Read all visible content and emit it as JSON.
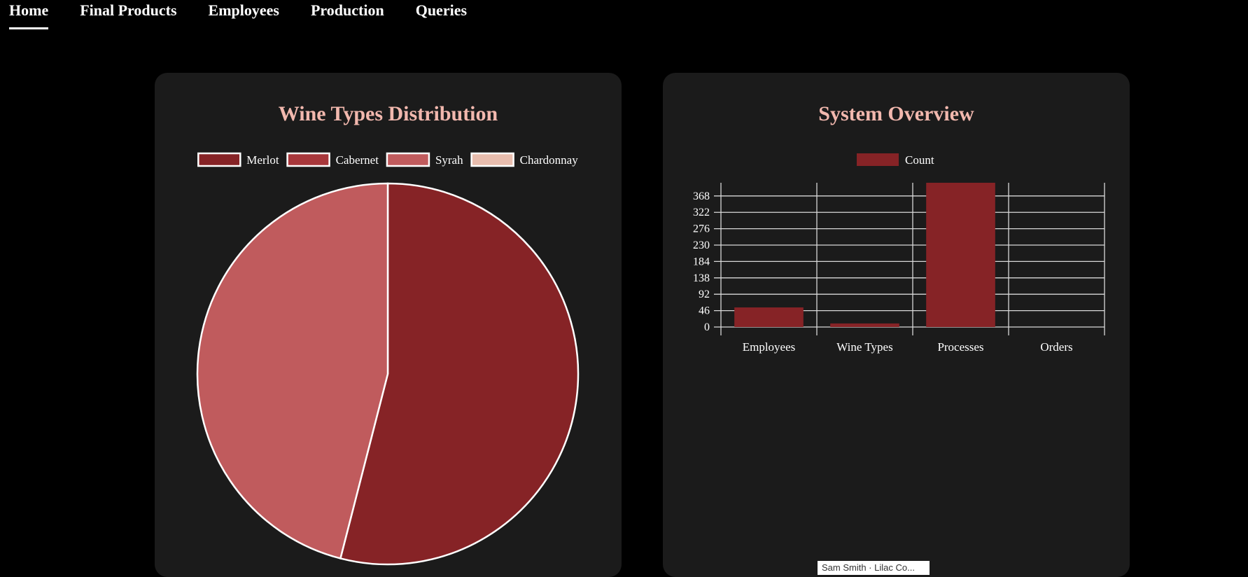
{
  "nav": {
    "items": [
      {
        "label": "Home",
        "active": true
      },
      {
        "label": "Final Products",
        "active": false
      },
      {
        "label": "Employees",
        "active": false
      },
      {
        "label": "Production",
        "active": false
      },
      {
        "label": "Queries",
        "active": false
      }
    ]
  },
  "colors": {
    "page_bg": "#000000",
    "card_bg": "#1b1b1b",
    "title": "#f2b8ae",
    "merlot": "#862326",
    "cabernet": "#a8373b",
    "syrah": "#c05b5d",
    "chardonnay": "#e8bdae",
    "bar": "#862326",
    "grid": "#d9d9d9"
  },
  "pie_card": {
    "title": "Wine Types Distribution"
  },
  "bar_card": {
    "title": "System Overview"
  },
  "chart_data": [
    {
      "type": "pie",
      "title": "Wine Types Distribution",
      "legend_placement": "top",
      "categories": [
        "Merlot",
        "Cabernet",
        "Syrah",
        "Chardonnay"
      ],
      "values": [
        54,
        0,
        46,
        0
      ],
      "colors": [
        "#862326",
        "#a8373b",
        "#c05b5d",
        "#e8bdae"
      ]
    },
    {
      "type": "bar",
      "title": "System Overview",
      "legend_placement": "top",
      "categories": [
        "Employees",
        "Wine Types",
        "Processes",
        "Orders"
      ],
      "series": [
        {
          "name": "Count",
          "values": [
            55,
            10,
            410,
            0
          ],
          "color": "#862326"
        }
      ],
      "y_ticks": [
        0,
        46,
        92,
        138,
        184,
        230,
        276,
        322,
        368
      ],
      "ylim": [
        0,
        405
      ],
      "grid": true
    }
  ],
  "tooltip": {
    "text": "Sam Smith · Lilac Co..."
  }
}
